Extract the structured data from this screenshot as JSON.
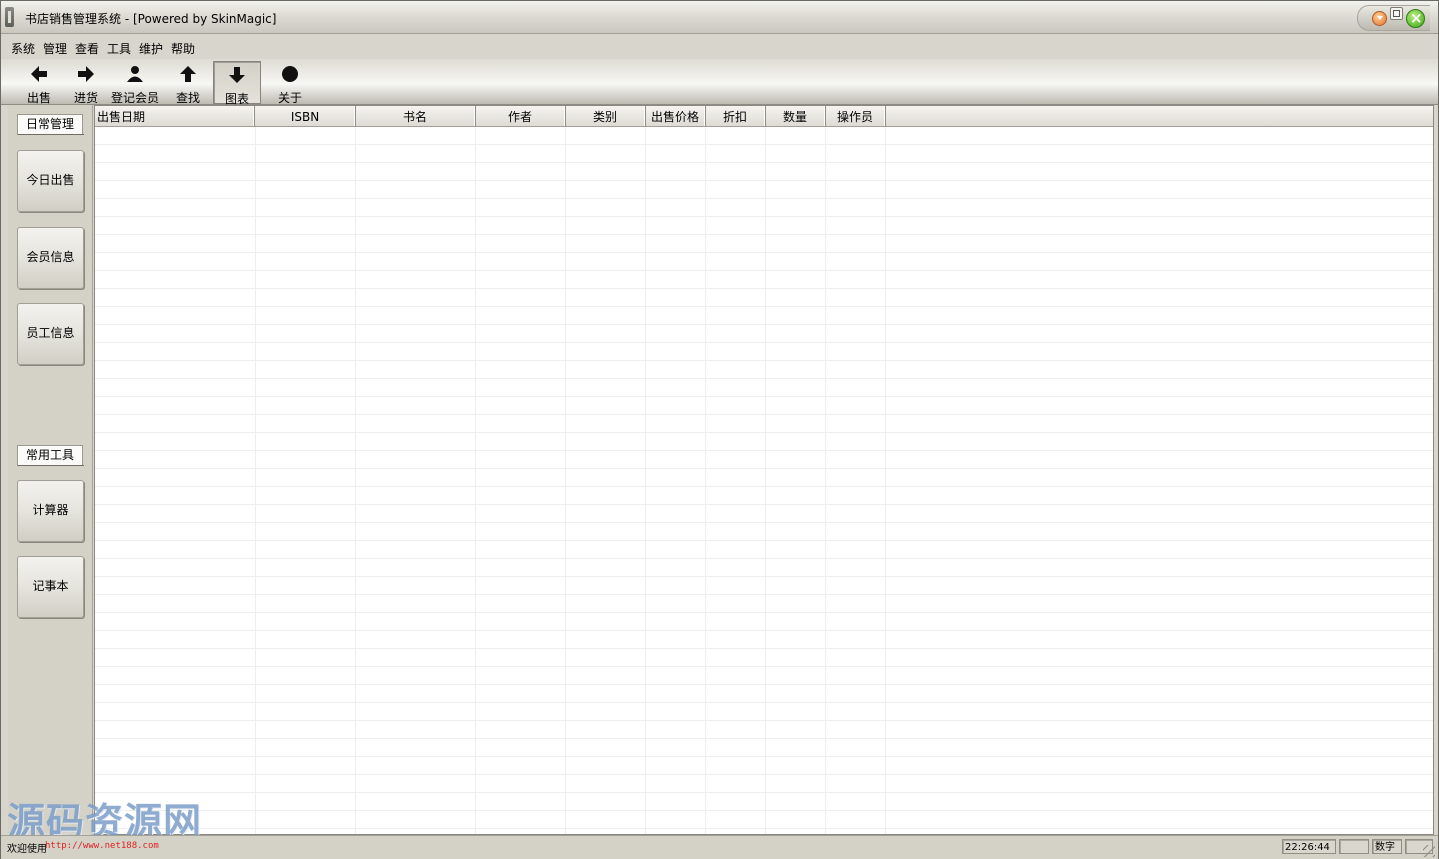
{
  "window": {
    "title": "书店销售管理系统 - [Powered by SkinMagic]"
  },
  "menu": [
    "系统",
    "管理",
    "查看",
    "工具",
    "维护",
    "帮助"
  ],
  "toolbar": {
    "sell": "出售",
    "restock": "进货",
    "register_member": "登记会员",
    "search": "查找",
    "chart": "图表",
    "about": "关于"
  },
  "sidebar": {
    "daily_group": "日常管理",
    "daily_items": [
      "今日出售",
      "会员信息",
      "员工信息"
    ],
    "tools_group": "常用工具",
    "tools_items": [
      "计算器",
      "记事本"
    ]
  },
  "table": {
    "columns": [
      "出售日期",
      "ISBN",
      "书名",
      "作者",
      "类别",
      "出售价格",
      "折扣",
      "数量",
      "操作员"
    ],
    "rows": []
  },
  "status": {
    "message": "欢迎使用",
    "url": "http://www.net188.com",
    "time": "22:26:44",
    "num_lock": "数字"
  },
  "watermark": "源码资源网",
  "colors": {
    "accent_close": "#3fa21a",
    "accent_minimize": "#e0742a",
    "watermark": "#7c9ec8",
    "url": "#dd2222"
  }
}
